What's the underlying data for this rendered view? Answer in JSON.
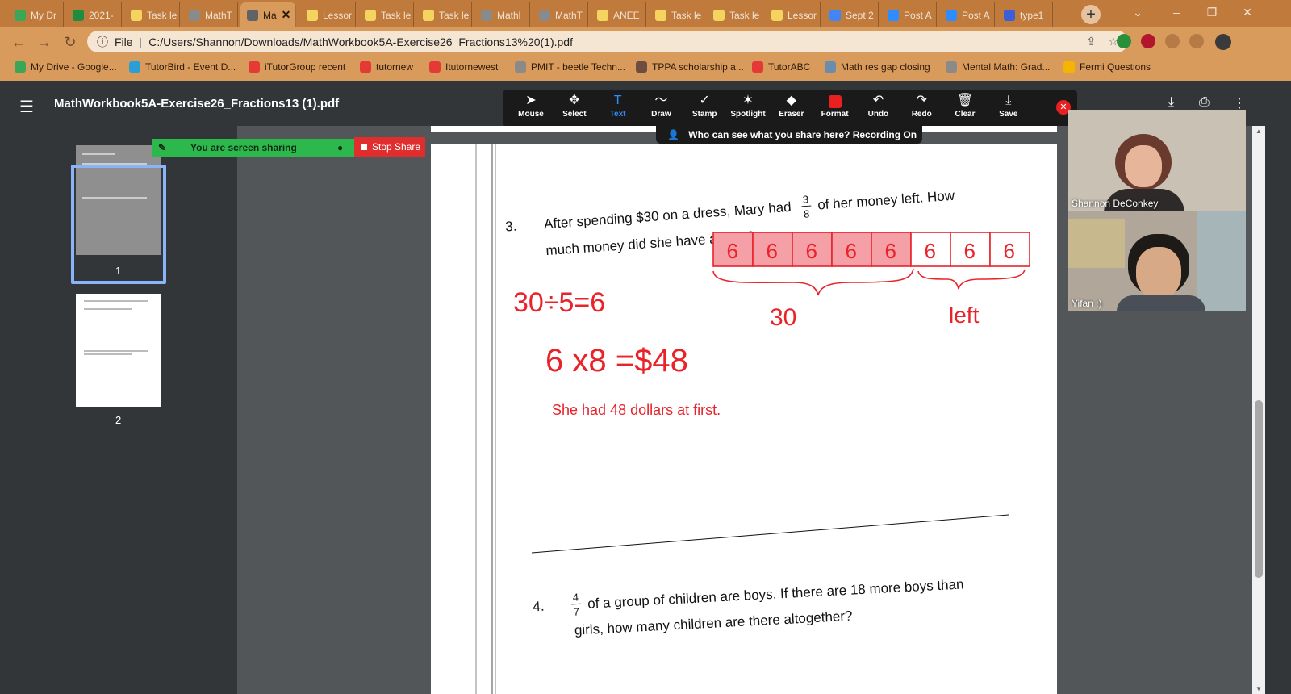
{
  "tabs": [
    {
      "label": "My Dr",
      "icon": "google-drive-icon",
      "color": "#3aa757"
    },
    {
      "label": "2021-",
      "icon": "sheets-icon",
      "color": "#1e8e3e"
    },
    {
      "label": "Task le",
      "icon": "lesson-icon",
      "color": "#f4d35e"
    },
    {
      "label": "MathT",
      "icon": "globe-icon",
      "color": "#8a8a8a"
    },
    {
      "label": "Ma",
      "icon": "globe-icon",
      "color": "#5f6368",
      "active": true
    },
    {
      "label": "Lessor",
      "icon": "lesson-icon",
      "color": "#f4d35e"
    },
    {
      "label": "Task le",
      "icon": "lesson-icon",
      "color": "#f4d35e"
    },
    {
      "label": "Task le",
      "icon": "lesson-icon",
      "color": "#f4d35e"
    },
    {
      "label": "Mathl",
      "icon": "globe-icon",
      "color": "#8a8a8a"
    },
    {
      "label": "MathT",
      "icon": "globe-icon",
      "color": "#8a8a8a"
    },
    {
      "label": "ANEE",
      "icon": "lesson-icon",
      "color": "#f4d35e"
    },
    {
      "label": "Task le",
      "icon": "lesson-icon",
      "color": "#f4d35e"
    },
    {
      "label": "Task le",
      "icon": "lesson-icon",
      "color": "#f4d35e"
    },
    {
      "label": "Lessor",
      "icon": "lesson-icon",
      "color": "#f4d35e"
    },
    {
      "label": "Sept 2",
      "icon": "docs-icon",
      "color": "#4285f4"
    },
    {
      "label": "Post A",
      "icon": "zoom-icon",
      "color": "#2d8cff"
    },
    {
      "label": "Post A",
      "icon": "zoom-icon",
      "color": "#2d8cff"
    },
    {
      "label": "type1",
      "icon": "mw4k-icon",
      "color": "#3b5fd9"
    }
  ],
  "address": {
    "scheme": "File",
    "url": "C:/Users/Shannon/Downloads/MathWorkbook5A-Exercise26_Fractions13%20(1).pdf"
  },
  "bookmarks": [
    {
      "label": "My Drive - Google...",
      "icon": "google-drive-icon",
      "color": "#3aa757"
    },
    {
      "label": "TutorBird - Event D...",
      "icon": "tutorbird-icon",
      "color": "#2a9fd6"
    },
    {
      "label": "iTutorGroup recent",
      "icon": "itutor-icon",
      "color": "#e53935"
    },
    {
      "label": "tutornew",
      "icon": "itutor-icon",
      "color": "#e53935"
    },
    {
      "label": "Itutornewest",
      "icon": "itutor-icon",
      "color": "#e53935"
    },
    {
      "label": "PMIT - beetle Techn...",
      "icon": "globe-icon",
      "color": "#8a8a8a"
    },
    {
      "label": "TPPA scholarship a...",
      "icon": "owl-icon",
      "color": "#6d4c41"
    },
    {
      "label": "TutorABC",
      "icon": "itutor-icon",
      "color": "#e53935"
    },
    {
      "label": "Math res gap closing",
      "icon": "globe-icon",
      "color": "#6a8caf"
    },
    {
      "label": "Mental Math: Grad...",
      "icon": "globe-icon",
      "color": "#8a8a8a"
    },
    {
      "label": "Fermi Questions",
      "icon": "fermi-icon",
      "color": "#f5b400"
    }
  ],
  "pdf": {
    "title": "MathWorkbook5A-Exercise26_Fractions13 (1).pdf",
    "thumbnails": [
      {
        "number": "1"
      },
      {
        "number": "2"
      }
    ]
  },
  "annotation_tools": [
    {
      "label": "Mouse",
      "glyph": "➤"
    },
    {
      "label": "Select",
      "glyph": "✥"
    },
    {
      "label": "Text",
      "glyph": "T",
      "active": true
    },
    {
      "label": "Draw",
      "glyph": "〜"
    },
    {
      "label": "Stamp",
      "glyph": "✓"
    },
    {
      "label": "Spotlight",
      "glyph": "✶"
    },
    {
      "label": "Eraser",
      "glyph": "◆"
    },
    {
      "label": "Format",
      "glyph": ""
    },
    {
      "label": "Undo",
      "glyph": "↶"
    },
    {
      "label": "Redo",
      "glyph": "↷"
    },
    {
      "label": "Clear",
      "glyph": "🗑"
    },
    {
      "label": "Save",
      "glyph": "⤓"
    }
  ],
  "share": {
    "notice": "Who can see what you share here? Recording On",
    "status": "You are screen sharing",
    "stop_label": "Stop Share"
  },
  "problem3": {
    "number": "3.",
    "text_before": "After spending $30 on a dress, Mary had",
    "fraction_num": "3",
    "fraction_den": "8",
    "text_after": "of her money left. How",
    "line2": "much money did she have at first?"
  },
  "problem4": {
    "number": "4.",
    "fraction_num": "4",
    "fraction_den": "7",
    "text_after": "of a group of children are boys. If there are 18 more boys than",
    "line2": "girls, how many children are there altogether?"
  },
  "annotations": {
    "bar_units": [
      "6",
      "6",
      "6",
      "6",
      "6",
      "6",
      "6",
      "6"
    ],
    "label_spent": "30",
    "label_left": "left",
    "calc1": "30÷5=6",
    "calc2": "6 x8 =$48",
    "answer": "She had 48 dollars at first.",
    "ink_color": "#e8232a",
    "fill_color": "#f4a0a6"
  },
  "participants": [
    {
      "name": "Shannon DeConkey"
    },
    {
      "name": "Yifan :)"
    }
  ]
}
